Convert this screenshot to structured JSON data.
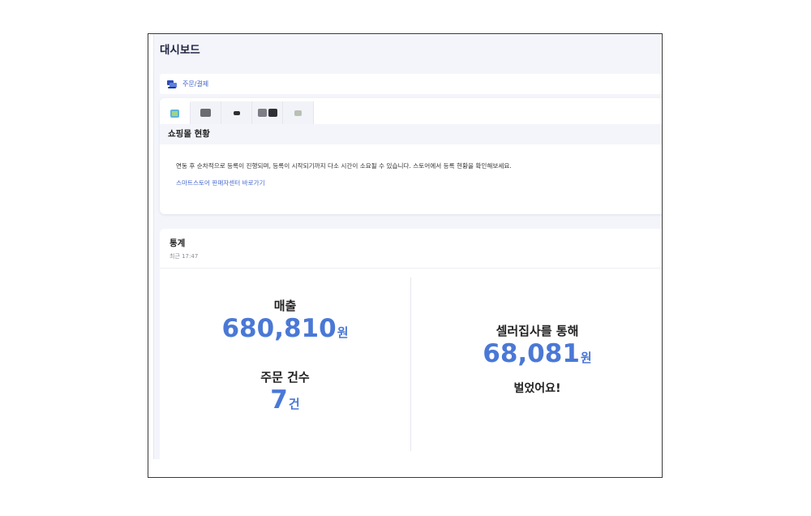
{
  "page": {
    "title": "대시보드"
  },
  "breadcrumb": {
    "label": "주문/결제"
  },
  "tabs": [
    {
      "name": "store-tab-1",
      "active": true
    },
    {
      "name": "store-tab-2",
      "active": false
    },
    {
      "name": "store-tab-3",
      "active": false
    },
    {
      "name": "store-tab-4",
      "active": false
    },
    {
      "name": "store-tab-5",
      "active": false
    }
  ],
  "mall_status": {
    "title": "쇼핑몰 현황",
    "notice": "연동 후 순차적으로 등록이 진행되며, 등록이 시작되기까지 다소 시간이 소요될 수 있습니다. 스토어에서 등록 현황을 확인해보세요.",
    "link": "스마트스토어 판매자센터 바로가기"
  },
  "stats": {
    "title": "통계",
    "updated": "최근 17:47",
    "sales": {
      "label": "매출",
      "value": "680,810",
      "unit": "원"
    },
    "orders": {
      "label": "주문 건수",
      "value": "7",
      "unit": "건"
    },
    "earned": {
      "label": "셀러집사를 통해",
      "value": "68,081",
      "unit": "원",
      "suffix": "벌었어요!"
    }
  },
  "colors": {
    "accent": "#4a78d6",
    "link": "#4a6bd0",
    "background": "#f4f5fb"
  }
}
